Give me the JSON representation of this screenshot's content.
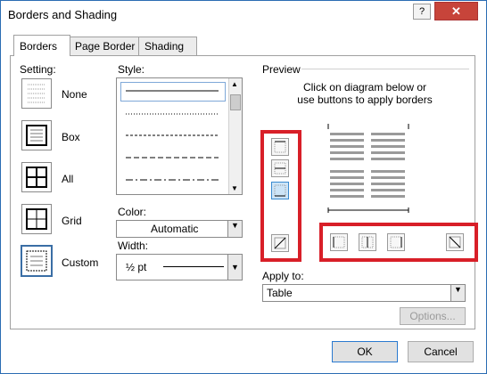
{
  "window": {
    "title": "Borders and Shading",
    "help": "?",
    "close": "✕"
  },
  "tabs": [
    {
      "label": "Borders",
      "active": true
    },
    {
      "label": "Page Border",
      "active": false
    },
    {
      "label": "Shading",
      "active": false
    }
  ],
  "setting": {
    "heading": "Setting:",
    "options": [
      {
        "label": "None",
        "icon": "none-border-icon"
      },
      {
        "label": "Box",
        "icon": "box-border-icon"
      },
      {
        "label": "All",
        "icon": "all-border-icon"
      },
      {
        "label": "Grid",
        "icon": "grid-border-icon"
      },
      {
        "label": "Custom",
        "icon": "custom-border-icon",
        "selected": true
      }
    ]
  },
  "style": {
    "heading": "Style:"
  },
  "color": {
    "label": "Color:",
    "value": "Automatic"
  },
  "width": {
    "label": "Width:",
    "value": "½ pt"
  },
  "preview": {
    "heading": "Preview",
    "instruction_line1": "Click on diagram below or",
    "instruction_line2": "use buttons to apply borders"
  },
  "apply_to": {
    "label": "Apply to:",
    "value": "Table"
  },
  "buttons": {
    "options": "Options...",
    "ok": "OK",
    "cancel": "Cancel"
  },
  "colors": {
    "highlight_red": "#d81f28",
    "accent_blue": "#2a7ad0"
  }
}
